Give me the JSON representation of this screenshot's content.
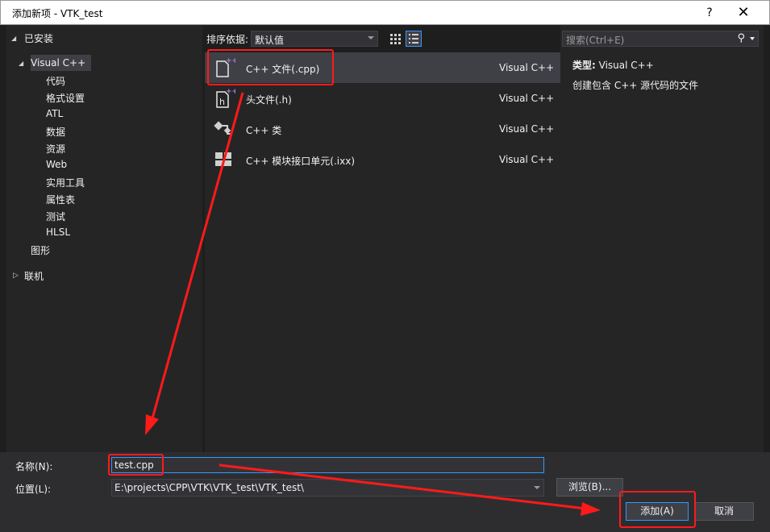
{
  "window": {
    "title": "添加新项 - VTK_test",
    "help_label": "?",
    "close_label": "✕"
  },
  "tree": {
    "installed": "已安装",
    "visual_cpp": "Visual C++",
    "children": [
      "代码",
      "格式设置",
      "ATL",
      "数据",
      "资源",
      "Web",
      "实用工具",
      "属性表",
      "测试",
      "HLSL"
    ],
    "graphics": "图形",
    "online": "联机"
  },
  "toolbar": {
    "sort_label": "排序依据:",
    "sort_value": "默认值"
  },
  "templates": [
    {
      "name": "C++ 文件(.cpp)",
      "lang": "Visual C++",
      "icon": "cpp-file-icon"
    },
    {
      "name": "头文件(.h)",
      "lang": "Visual C++",
      "icon": "header-file-icon"
    },
    {
      "name": "C++ 类",
      "lang": "Visual C++",
      "icon": "cpp-class-icon"
    },
    {
      "name": "C++ 模块接口单元(.ixx)",
      "lang": "Visual C++",
      "icon": "module-unit-icon"
    }
  ],
  "details": {
    "search_placeholder": "搜索(Ctrl+E)",
    "type_label": "类型:",
    "type_value": "Visual C++",
    "description": "创建包含 C++ 源代码的文件"
  },
  "form": {
    "name_label": "名称(N):",
    "name_value": "test.cpp",
    "location_label": "位置(L):",
    "location_value": "E:\\projects\\CPP\\VTK\\VTK_test\\VTK_test\\",
    "browse_label": "浏览(B)...",
    "add_label": "添加(A)",
    "cancel_label": "取消"
  },
  "colors": {
    "highlight": "#ff1a1a",
    "accent": "#3399ff",
    "icon_purple": "#b180d7"
  }
}
